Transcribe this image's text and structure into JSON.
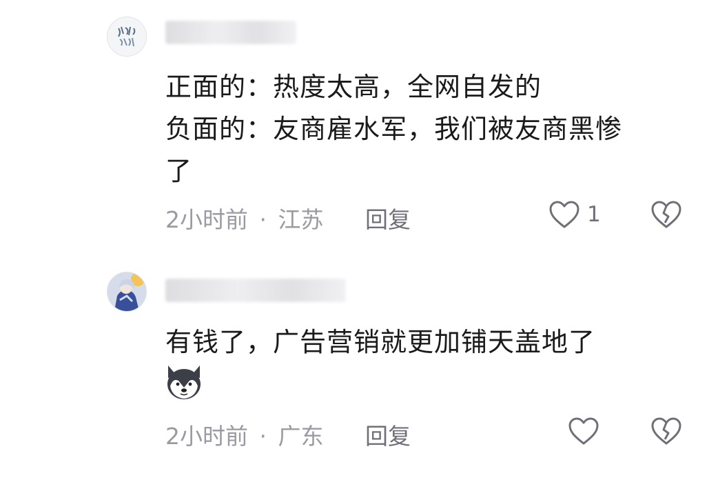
{
  "comments": [
    {
      "lines": [
        "正面的：热度太高，全网自发的",
        "负面的：友商雇水军，我们被友商黑惨",
        "了"
      ],
      "time": "2小时前",
      "separator": "·",
      "location": "江苏",
      "reply_label": "回复",
      "like_count": "1",
      "avatar_icon": "calligraphy-avatar-icon"
    },
    {
      "lines": [
        "有钱了，广告营销就更加铺天盖地了"
      ],
      "emoji": "husky-dog-emoji",
      "time": "2小时前",
      "separator": "·",
      "location": "广东",
      "reply_label": "回复",
      "like_count": "",
      "avatar_icon": "anime-character-avatar-icon"
    }
  ],
  "colors": {
    "text": "#1a1a1a",
    "meta": "#9a9aa3",
    "icon": "#6f6f78"
  }
}
